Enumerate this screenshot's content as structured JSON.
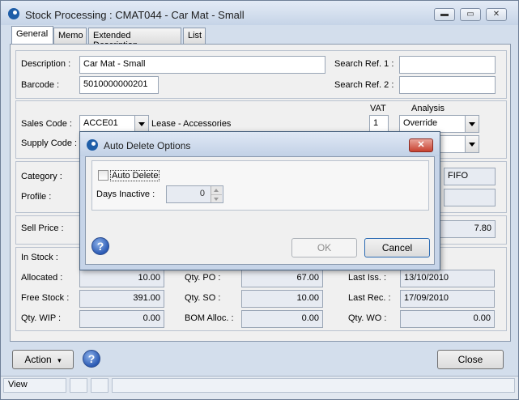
{
  "window": {
    "title": "Stock Processing : CMAT044 - Car Mat - Small",
    "minimize_glyph": "▬",
    "maximize_glyph": "▭",
    "close_glyph": "✕"
  },
  "tabs": [
    "General",
    "Memo",
    "Extended Description",
    "List"
  ],
  "general": {
    "description_label": "Description :",
    "description_value": "Car Mat - Small",
    "barcode_label": "Barcode :",
    "barcode_value": "5010000000201",
    "search_ref1_label": "Search Ref. 1 :",
    "search_ref1_value": "",
    "search_ref2_label": "Search Ref. 2 :",
    "search_ref2_value": "",
    "vat_header": "VAT",
    "analysis_header": "Analysis",
    "sales_code_label": "Sales Code :",
    "sales_code_value": "ACCE01",
    "sales_code_desc": "Lease - Accessories",
    "sales_vat_value": "1",
    "sales_analysis_value": "Override",
    "supply_code_label": "Supply Code :",
    "category_label": "Category :",
    "costing_value": "FIFO",
    "profile_label": "Profile :",
    "sell_price_label": "Sell Price :",
    "sell_price_value": "7.80",
    "in_stock_label": "In Stock :",
    "allocated_label": "Allocated :",
    "allocated_value": "10.00",
    "qty_po_label": "Qty. PO :",
    "qty_po_value": "67.00",
    "last_iss_label": "Last Iss. :",
    "last_iss_value": "13/10/2010",
    "free_stock_label": "Free Stock :",
    "free_stock_value": "391.00",
    "qty_so_label": "Qty. SO :",
    "qty_so_value": "10.00",
    "last_rec_label": "Last Rec. :",
    "last_rec_value": "17/09/2010",
    "qty_wip_label": "Qty. WIP :",
    "qty_wip_value": "0.00",
    "bom_alloc_label": "BOM Alloc. :",
    "bom_alloc_value": "0.00",
    "qty_wo_label": "Qty. WO :",
    "qty_wo_value": "0.00"
  },
  "footer": {
    "action_label": "Action",
    "action_arrow": "▾",
    "help_glyph": "?",
    "close_label": "Close"
  },
  "status": {
    "view_label": "View"
  },
  "dialog": {
    "title": "Auto Delete Options",
    "close_glyph": "✕",
    "auto_delete_label": "Auto Delete",
    "days_inactive_label": "Days  Inactive :",
    "days_inactive_value": "0",
    "help_glyph": "?",
    "ok_label": "OK",
    "cancel_label": "Cancel"
  }
}
